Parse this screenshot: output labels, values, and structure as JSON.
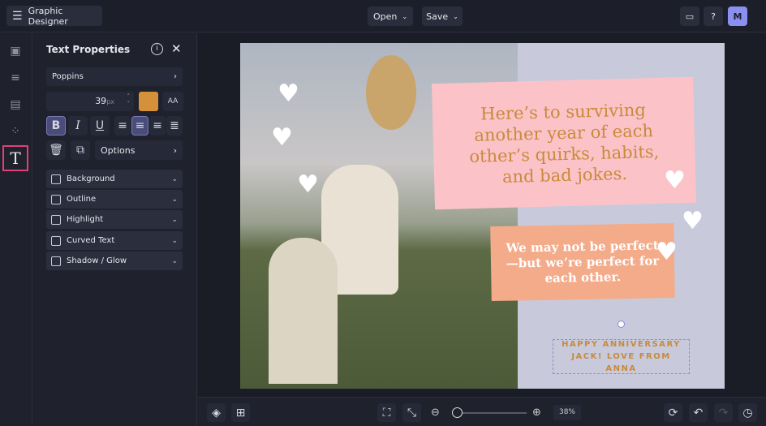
{
  "header": {
    "app_title": "Graphic Designer",
    "open_label": "Open",
    "save_label": "Save",
    "avatar_initial": "M"
  },
  "panel": {
    "title": "Text Properties",
    "font": "Poppins",
    "font_size": "39",
    "font_size_unit": "px",
    "text_color": "#d4913a",
    "options_label": "Options",
    "accordions": [
      {
        "label": "Background"
      },
      {
        "label": "Outline"
      },
      {
        "label": "Highlight"
      },
      {
        "label": "Curved Text"
      },
      {
        "label": "Shadow / Glow"
      }
    ]
  },
  "canvas": {
    "headline": "Here’s to surviving another year of each other’s quirks, habits, and bad jokes.",
    "subtext": "We may not be perfect—but we’re perfect for each other.",
    "selected_text": "HAPPY ANNIVERSARY JACK! LOVE FROM ANNA"
  },
  "footer": {
    "zoom_level": "38%",
    "zoom_fraction": 0.0
  },
  "colors": {
    "accent": "#e0407a",
    "pink_box": "#fbc3c8",
    "peach_box": "#f3ab8a",
    "headline_text": "#c98a3a"
  }
}
